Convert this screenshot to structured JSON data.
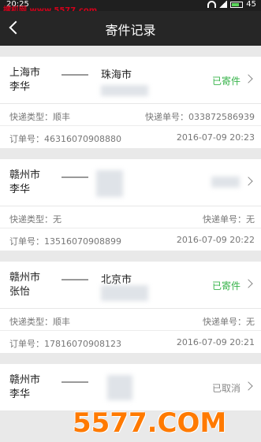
{
  "status_bar": {
    "time": "20:25",
    "battery": "45"
  },
  "watermark_top": "搜机网 www.5577.com",
  "header": {
    "title": "寄件记录"
  },
  "records": [
    {
      "from_city": "上海市",
      "from_name": "李华",
      "to_city": "珠海市",
      "status": "已寄件",
      "courier_label": "快递类型：顺丰",
      "tracking_label": "快递单号：033872586939",
      "order_label": "订单号：46316070908880",
      "date": "2016-07-09 20:23"
    },
    {
      "from_city": "赣州市",
      "from_name": "李华",
      "to_city": "",
      "status": "",
      "courier_label": "快递类型：无",
      "tracking_label": "快递单号：无",
      "order_label": "订单号：13516070908899",
      "date": "2016-07-09 20:22"
    },
    {
      "from_city": "赣州市",
      "from_name": "张怡",
      "to_city": "北京市",
      "status": "已寄件",
      "courier_label": "快递类型：顺丰",
      "tracking_label": "快递单号：无",
      "order_label": "订单号：17816070908123",
      "date": "2016-07-09 20:21"
    },
    {
      "from_city": "赣州市",
      "from_name": "李华",
      "to_city": "",
      "status": "已取消"
    }
  ],
  "watermark_bottom": "5577.COM"
}
